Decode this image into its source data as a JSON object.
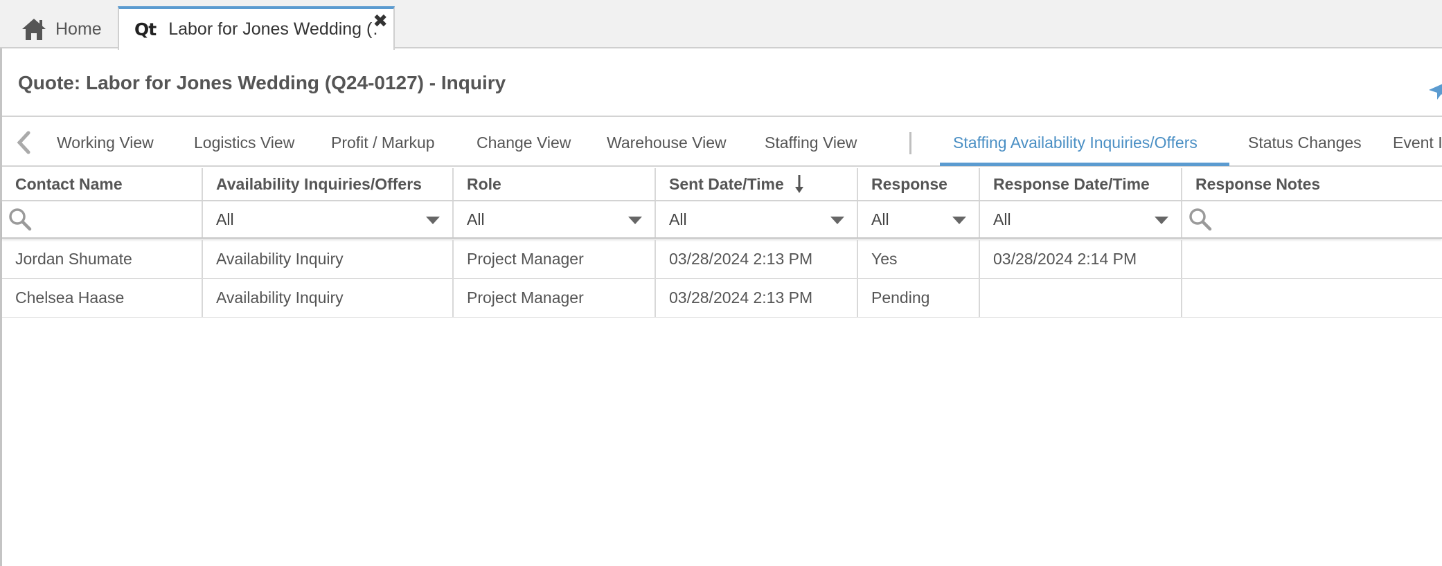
{
  "tabs": {
    "home_label": "Home",
    "doc_icon": "Qt",
    "doc_label": "Labor for Jones Wedding (…",
    "close_glyph": "✖"
  },
  "page": {
    "title": "Quote: Labor for Jones Wedding (Q24-0127) - Inquiry"
  },
  "view_tabs": [
    {
      "label": "Working View"
    },
    {
      "label": "Logistics View"
    },
    {
      "label": "Profit / Markup"
    },
    {
      "label": "Change View"
    },
    {
      "label": "Warehouse View"
    },
    {
      "label": "Staffing View"
    },
    {
      "label": "Staffing Availability Inquiries/Offers",
      "active": true
    },
    {
      "label": "Status Changes"
    },
    {
      "label": "Event I"
    }
  ],
  "grid": {
    "columns": [
      "Contact Name",
      "Availability Inquiries/Offers",
      "Role",
      "Sent Date/Time",
      "Response",
      "Response Date/Time",
      "Response Notes"
    ],
    "filters": [
      "",
      "All",
      "All",
      "All",
      "All",
      "All",
      ""
    ],
    "rows": [
      [
        "Jordan Shumate",
        "Availability Inquiry",
        "Project Manager",
        "03/28/2024 2:13 PM",
        "Yes",
        "03/28/2024 2:14 PM",
        ""
      ],
      [
        "Chelsea Haase",
        "Availability Inquiry",
        "Project Manager",
        "03/28/2024 2:13 PM",
        "Pending",
        "",
        ""
      ]
    ],
    "sort_column": "Sent Date/Time",
    "sort_direction": "descending"
  },
  "icons": {
    "home": "home-icon",
    "close": "close-icon",
    "send": "send-icon",
    "back": "chevron-left-icon",
    "search": "search-icon",
    "sort": "sort-desc-arrow-icon",
    "dropdown": "dropdown-triangle-icon"
  },
  "colors": {
    "accent": "#5b9bd0",
    "active_tab_text": "#4a8fc4",
    "tabstrip_bg": "#f1f1f1"
  }
}
